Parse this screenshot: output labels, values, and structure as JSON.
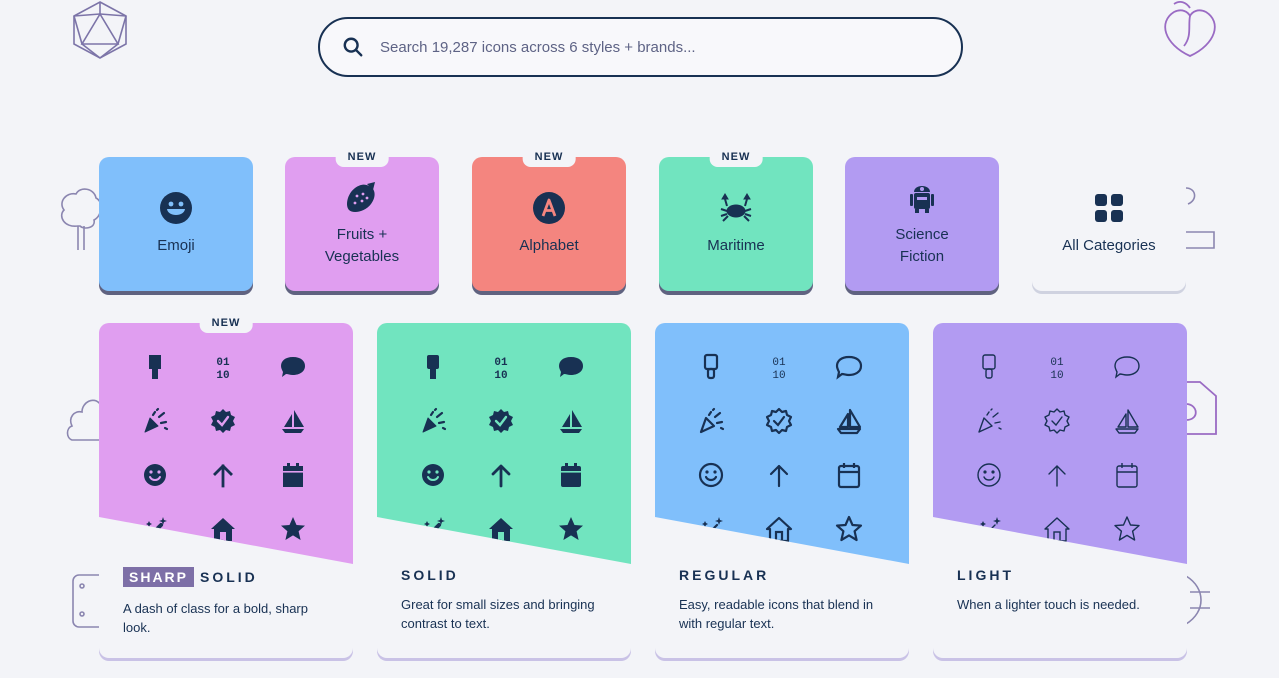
{
  "search": {
    "placeholder": "Search 19,287 icons across 6 styles + brands...",
    "icon": "search-icon"
  },
  "categories": [
    {
      "label": "Emoji",
      "color": "#80bffb",
      "icon": "grin-face-icon",
      "badge": ""
    },
    {
      "label": "Fruits + Vegetables",
      "color": "#e09ef0",
      "icon": "strawberry-icon",
      "badge": "NEW"
    },
    {
      "label": "Alphabet",
      "color": "#f4857f",
      "icon": "letter-a-circle-icon",
      "badge": "NEW"
    },
    {
      "label": "Maritime",
      "color": "#71e4bf",
      "icon": "crab-icon",
      "badge": "NEW"
    },
    {
      "label": "Science Fiction",
      "color": "#b29bf2",
      "icon": "robot-icon",
      "badge": ""
    },
    {
      "label": "All Categories",
      "color": "#f3f4f8",
      "icon": "grid-icon",
      "badge": ""
    }
  ],
  "styles": [
    {
      "tag": "SHARP",
      "title": "SOLID",
      "desc": "A dash of class for a bold, sharp look.",
      "color": "#e09ef0",
      "badge": "NEW"
    },
    {
      "tag": "",
      "title": "SOLID",
      "desc": "Great for small sizes and bringing contrast to text.",
      "color": "#71e4bf",
      "badge": ""
    },
    {
      "tag": "",
      "title": "REGULAR",
      "desc": "Easy, readable icons that blend in with regular text.",
      "color": "#80bffb",
      "badge": ""
    },
    {
      "tag": "",
      "title": "LIGHT",
      "desc": "When a lighter touch is needed.",
      "color": "#b29bf2",
      "badge": ""
    }
  ],
  "style_icons": [
    "paintbrush-icon",
    "binary-icon",
    "comment-icon",
    "party-horn-icon",
    "badge-check-icon",
    "sailboat-icon",
    "smile-icon",
    "arrow-up-icon",
    "calendar-icon",
    "magic-wand-icon",
    "house-icon",
    "star-icon"
  ],
  "style_icon_text": {
    "binary": "01\n10"
  }
}
